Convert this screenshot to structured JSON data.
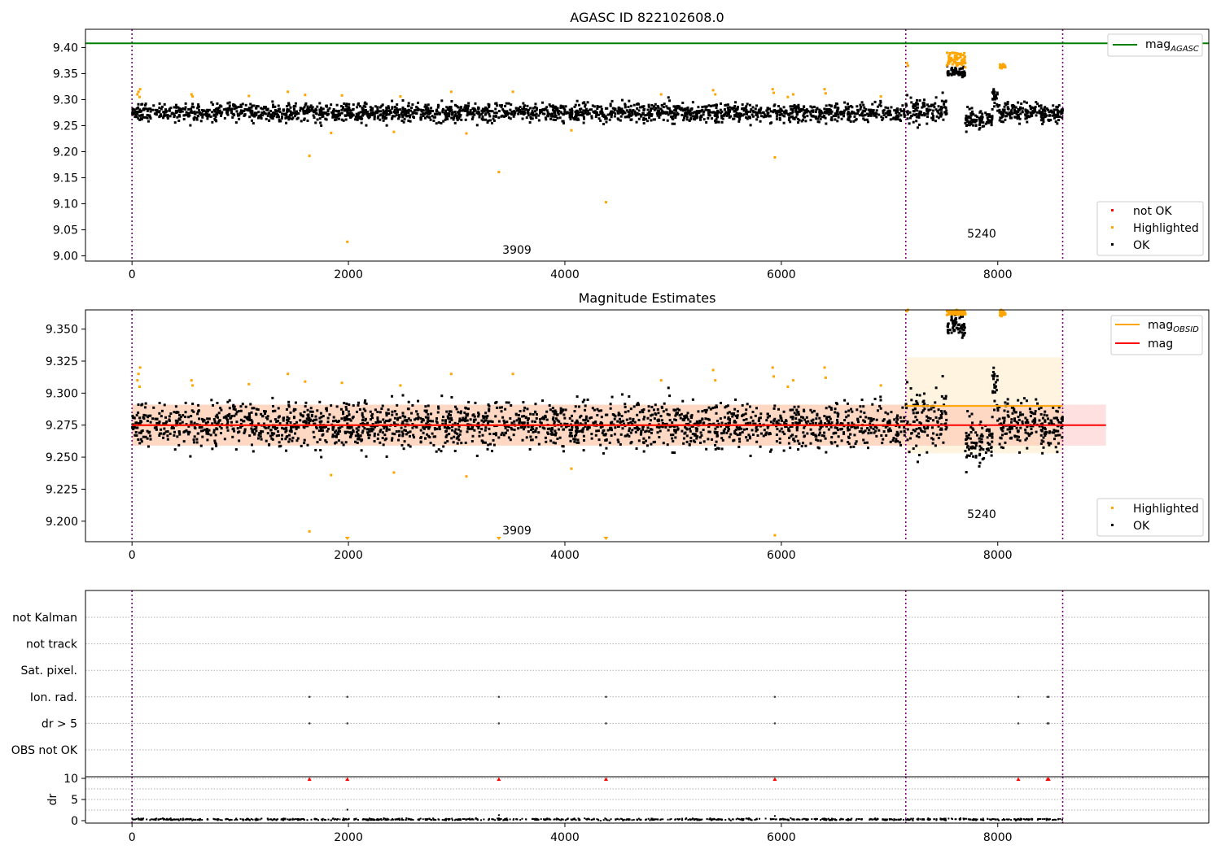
{
  "chart_data": [
    {
      "type": "scatter",
      "title": "AGASC ID 822102608.0",
      "xlim": [
        -430,
        9950
      ],
      "ylim": [
        8.99,
        9.435
      ],
      "x_ticks": [
        0,
        2000,
        4000,
        6000,
        8000
      ],
      "y_ticks": [
        9.0,
        9.05,
        9.1,
        9.15,
        9.2,
        9.25,
        9.3,
        9.35,
        9.4
      ],
      "y_tick_labels": [
        "9.00",
        "9.05",
        "9.10",
        "9.15",
        "9.20",
        "9.25",
        "9.30",
        "9.35",
        "9.40"
      ],
      "hlines": [
        {
          "name": "magAGASC",
          "label_base": "mag",
          "label_sub": "AGASC",
          "y": 9.408,
          "color": "#008000"
        }
      ],
      "vlines": [
        0,
        7150,
        8600
      ],
      "annotations": [
        {
          "text": "3909",
          "x": 3490,
          "y": 9.005
        },
        {
          "text": "5240",
          "x": 7790,
          "y": 9.036
        }
      ],
      "legends": [
        {
          "position": "upper right",
          "entries": [
            {
              "label_base": "mag",
              "label_sub": "AGASC",
              "kind": "line",
              "color": "#008000"
            }
          ]
        },
        {
          "position": "lower right",
          "entries": [
            {
              "label": "not OK",
              "kind": "dot",
              "color": "#ff0000"
            },
            {
              "label": "Highlighted",
              "kind": "dot",
              "color": "#ffa500"
            },
            {
              "label": "OK",
              "kind": "dot",
              "color": "#000000"
            }
          ]
        }
      ],
      "series": [
        {
          "name": "OK",
          "color": "#000000",
          "segments": [
            {
              "x0": 0,
              "x1": 7150,
              "n": 2100,
              "center": 9.275,
              "spread": 0.012
            },
            {
              "x0": 7150,
              "x1": 7530,
              "n": 120,
              "center": 9.28,
              "spread": 0.018
            },
            {
              "x0": 7530,
              "x1": 7700,
              "n": 70,
              "center": 9.352,
              "spread": 0.006
            },
            {
              "x0": 7700,
              "x1": 7950,
              "n": 90,
              "center": 9.262,
              "spread": 0.012
            },
            {
              "x0": 7950,
              "x1": 8000,
              "n": 25,
              "center": 9.3,
              "spread": 0.015
            },
            {
              "x0": 8000,
              "x1": 8600,
              "n": 200,
              "center": 9.275,
              "spread": 0.014
            }
          ]
        },
        {
          "name": "Highlighted",
          "color": "#ffa500",
          "points": [
            [
              50,
              9.31
            ],
            [
              60,
              9.315
            ],
            [
              70,
              9.305
            ],
            [
              75,
              9.32
            ],
            [
              550,
              9.31
            ],
            [
              560,
              9.306
            ],
            [
              1080,
              9.307
            ],
            [
              1440,
              9.315
            ],
            [
              1600,
              9.309
            ],
            [
              1640,
              9.192
            ],
            [
              1840,
              9.236
            ],
            [
              1940,
              9.308
            ],
            [
              1990,
              9.027
            ],
            [
              2420,
              9.238
            ],
            [
              2480,
              9.306
            ],
            [
              2950,
              9.315
            ],
            [
              3090,
              9.235
            ],
            [
              3390,
              9.161
            ],
            [
              3520,
              9.315
            ],
            [
              4060,
              9.241
            ],
            [
              4380,
              9.103
            ],
            [
              4890,
              9.31
            ],
            [
              5370,
              9.318
            ],
            [
              5390,
              9.31
            ],
            [
              5920,
              9.32
            ],
            [
              5930,
              9.313
            ],
            [
              5940,
              9.189
            ],
            [
              6060,
              9.305
            ],
            [
              6110,
              9.31
            ],
            [
              6400,
              9.32
            ],
            [
              6410,
              9.312
            ],
            [
              6920,
              9.306
            ],
            [
              7160,
              9.37
            ],
            [
              7170,
              9.365
            ],
            [
              7540,
              9.37
            ],
            [
              7560,
              9.38
            ],
            [
              7580,
              9.39
            ],
            [
              7600,
              9.375
            ],
            [
              7620,
              9.365
            ],
            [
              7640,
              9.38
            ],
            [
              7670,
              9.37
            ],
            [
              7700,
              9.362
            ],
            [
              8030,
              9.365
            ],
            [
              8050,
              9.368
            ],
            [
              8070,
              9.362
            ]
          ]
        },
        {
          "name": "not OK",
          "color": "#ff0000",
          "points": []
        }
      ]
    },
    {
      "type": "scatter",
      "title": "Magnitude Estimates",
      "xlim": [
        -430,
        9950
      ],
      "ylim": [
        9.184,
        9.365
      ],
      "x_ticks": [
        0,
        2000,
        4000,
        6000,
        8000
      ],
      "y_ticks": [
        9.2,
        9.225,
        9.25,
        9.275,
        9.3,
        9.325,
        9.35
      ],
      "y_tick_labels": [
        "9.200",
        "9.225",
        "9.250",
        "9.275",
        "9.300",
        "9.325",
        "9.350"
      ],
      "vlines": [
        0,
        7150,
        8600
      ],
      "bands": [
        {
          "name": "mag range",
          "x0": 0,
          "x1": 9000,
          "y0": 9.259,
          "y1": 9.291,
          "color": "#ff0000",
          "opacity": 0.12
        },
        {
          "name": "obsid range 1",
          "x0": 0,
          "x1": 7150,
          "y0": 9.259,
          "y1": 9.291,
          "color": "#ffa500",
          "opacity": 0.12
        },
        {
          "name": "obsid range 2",
          "x0": 7150,
          "x1": 8600,
          "y0": 9.253,
          "y1": 9.328,
          "color": "#ffa500",
          "opacity": 0.12
        }
      ],
      "lines": [
        {
          "name": "magOBSID",
          "color": "#ffa500",
          "segments": [
            {
              "x0": 0,
              "x1": 7150,
              "y": 9.275
            },
            {
              "x0": 7150,
              "x1": 8600,
              "y": 9.29
            }
          ]
        },
        {
          "name": "mag",
          "color": "#ff0000",
          "segments": [
            {
              "x0": 0,
              "x1": 9000,
              "y": 9.275
            }
          ]
        }
      ],
      "annotations": [
        {
          "text": "3909",
          "x": 3490,
          "y": 9.19
        },
        {
          "text": "5240",
          "x": 7790,
          "y": 9.203
        }
      ],
      "legends": [
        {
          "position": "upper right",
          "entries": [
            {
              "label_base": "mag",
              "label_sub": "OBSID",
              "kind": "line",
              "color": "#ffa500"
            },
            {
              "label": "mag",
              "kind": "line",
              "color": "#ff0000"
            }
          ]
        },
        {
          "position": "lower right",
          "entries": [
            {
              "label": "Highlighted",
              "kind": "dot",
              "color": "#ffa500"
            },
            {
              "label": "OK",
              "kind": "dot",
              "color": "#000000"
            }
          ]
        }
      ]
    },
    {
      "type": "scatter",
      "title": "",
      "xlim": [
        -430,
        9950
      ],
      "x_ticks": [
        0,
        2000,
        4000,
        6000,
        8000
      ],
      "categories": [
        "not Kalman",
        "not track",
        "Sat. pixel.",
        "Ion. rad.",
        "dr > 5",
        "OBS not OK"
      ],
      "vlines": [
        0,
        7150,
        8600
      ],
      "flag_points": [
        {
          "category": "Ion. rad.",
          "x": [
            1640,
            1990,
            3390,
            4380,
            5940,
            8190,
            8460,
            8470
          ]
        },
        {
          "category": "dr > 5",
          "x": [
            1640,
            1990,
            3390,
            4380,
            5940,
            8190,
            8460,
            8470
          ]
        }
      ]
    },
    {
      "type": "scatter",
      "title": "",
      "ylabel": "dr",
      "xlim": [
        -430,
        9950
      ],
      "ylim": [
        -0.3,
        10.4
      ],
      "x_ticks": [
        0,
        2000,
        4000,
        6000,
        8000
      ],
      "y_ticks": [
        0,
        5,
        10
      ],
      "vlines": [
        0,
        7150,
        8600
      ],
      "markers": {
        "color": "#ff0000",
        "y": 9.8,
        "x": [
          1640,
          1990,
          3390,
          4380,
          5940,
          8190,
          8460,
          8470
        ]
      },
      "outliers": [
        [
          1990,
          2.6
        ],
        [
          3390,
          1.3
        ],
        [
          5940,
          1.1
        ]
      ],
      "baseline": {
        "x0": 0,
        "x1": 8600,
        "center": 0.3,
        "spread": 0.15
      }
    }
  ]
}
